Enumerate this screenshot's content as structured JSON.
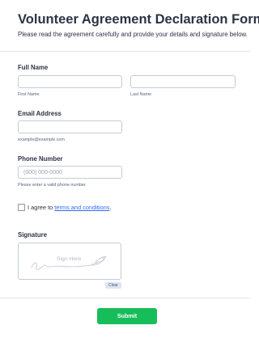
{
  "form": {
    "title": "Volunteer Agreement Declaration Form",
    "subtitle": "Please read the agreement carefully and provide your details and signature below."
  },
  "full_name": {
    "label": "Full Name",
    "first_value": "",
    "first_sublabel": "First Name",
    "last_value": "",
    "last_sublabel": "Last Name"
  },
  "email": {
    "label": "Email Address",
    "value": "",
    "sublabel": "example@example.com"
  },
  "phone": {
    "label": "Phone Number",
    "placeholder": "(000) 000-0000",
    "sublabel": "Please enter a valid phone number."
  },
  "agreement": {
    "checked": false,
    "text": "I agree to ",
    "link_text": "terms and conditions",
    "suffix": "."
  },
  "signature": {
    "label": "Signature",
    "hint": "Sign Here",
    "clear_label": "Clear"
  },
  "submit_label": "Submit",
  "colors": {
    "submit": "#18bd5b",
    "link": "#2e69ff",
    "text": "#2c3345"
  }
}
